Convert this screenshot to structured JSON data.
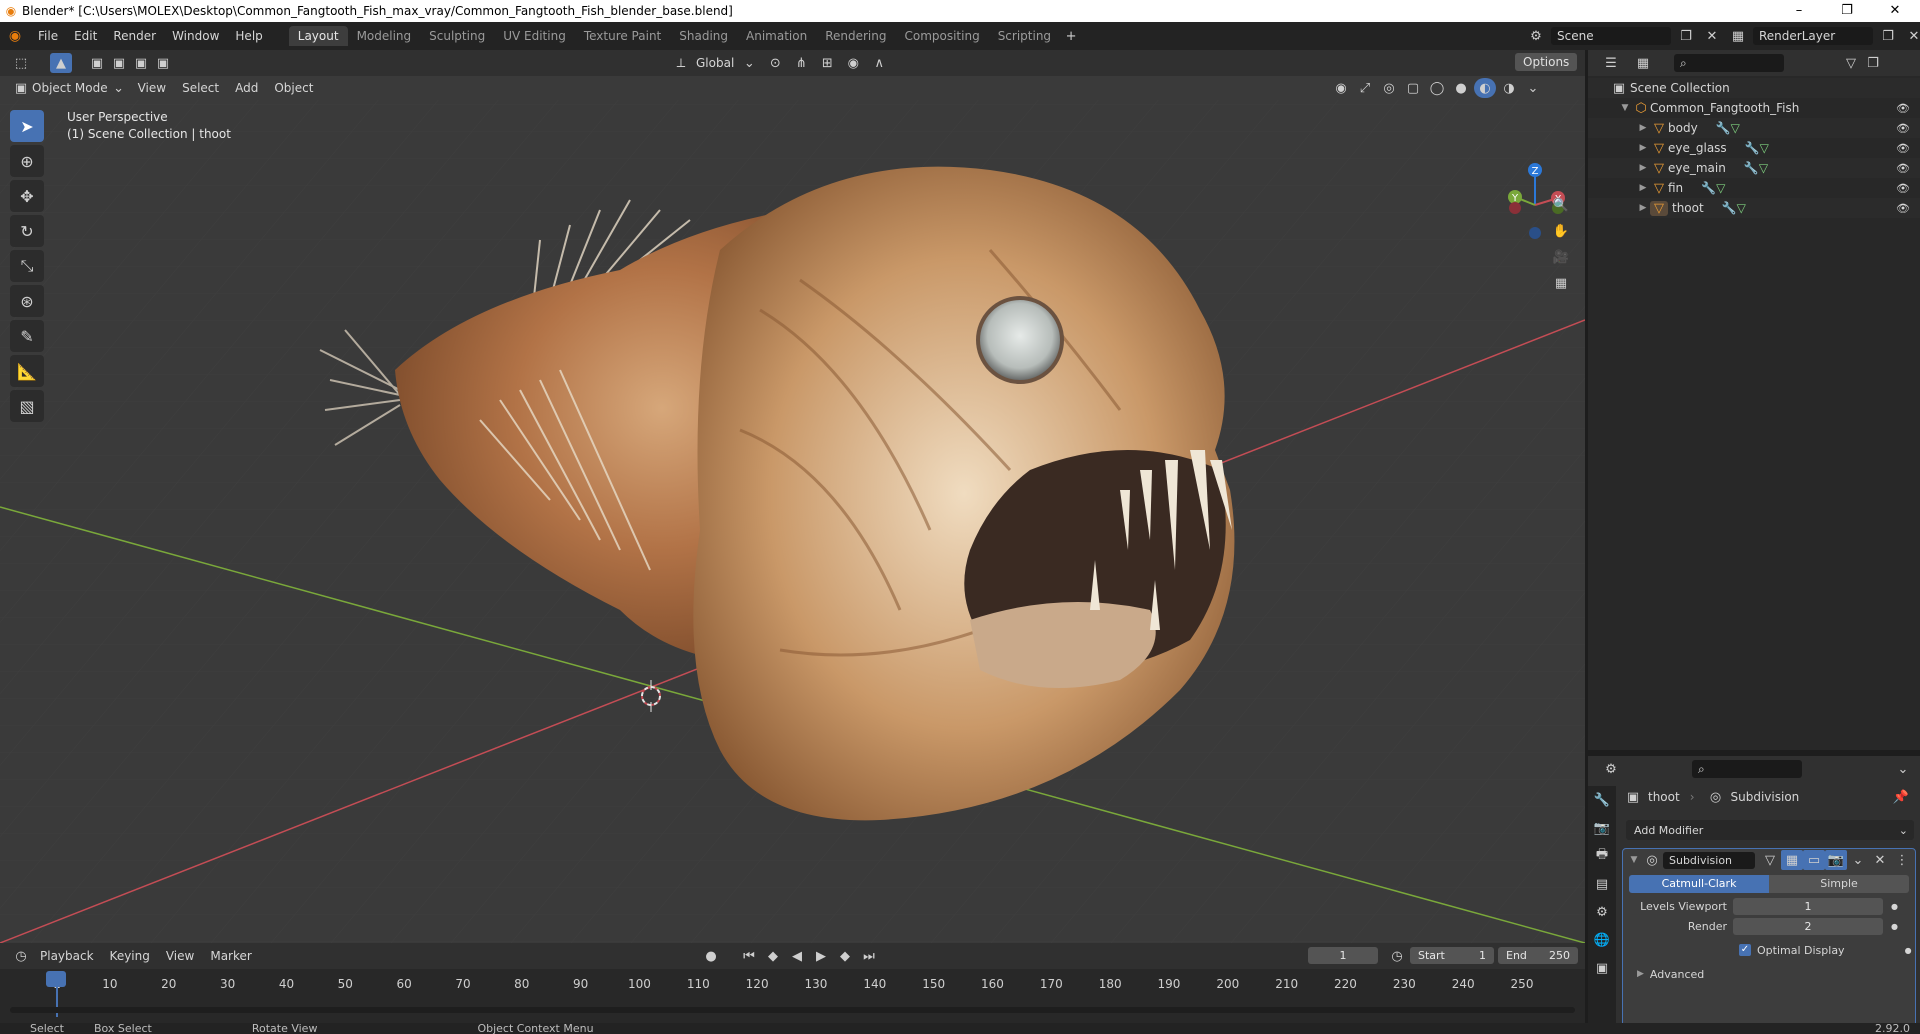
{
  "window": {
    "title": "Blender* [C:\\Users\\MOLEX\\Desktop\\Common_Fangtooth_Fish_max_vray/Common_Fangtooth_Fish_blender_base.blend]",
    "minimize": "–",
    "maximize": "❐",
    "close": "✕"
  },
  "menu": [
    "File",
    "Edit",
    "Render",
    "Window",
    "Help"
  ],
  "workspaces": [
    "Layout",
    "Modeling",
    "Sculpting",
    "UV Editing",
    "Texture Paint",
    "Shading",
    "Animation",
    "Rendering",
    "Compositing",
    "Scripting"
  ],
  "scene": {
    "name": "Scene",
    "render_layer": "RenderLayer"
  },
  "viewport": {
    "mode": "Object Mode",
    "menus": [
      "View",
      "Select",
      "Add",
      "Object"
    ],
    "orientation": "Global",
    "options": "Options",
    "perspective": "User Perspective",
    "collection_info": "(1) Scene Collection | thoot",
    "gizmo_axes": {
      "x": "X",
      "y": "Y",
      "z": "Z"
    }
  },
  "outliner": {
    "root": "Scene Collection",
    "collection": "Common_Fangtooth_Fish",
    "objects": [
      "body",
      "eye_glass",
      "eye_main",
      "fin",
      "thoot"
    ]
  },
  "properties": {
    "object": "thoot",
    "modifier_crumb": "Subdivision",
    "add_modifier": "Add Modifier",
    "modifier_name": "Subdivision",
    "tabs": [
      "Catmull-Clark",
      "Simple"
    ],
    "levels_viewport_label": "Levels Viewport",
    "levels_viewport": "1",
    "render_label": "Render",
    "render": "2",
    "optimal_display": "Optimal Display",
    "advanced": "Advanced"
  },
  "timeline": {
    "menus": [
      "Playback",
      "Keying",
      "View",
      "Marker"
    ],
    "current_frame": "1",
    "start_label": "Start",
    "start": "1",
    "end_label": "End",
    "end": "250",
    "ticks": [
      "1",
      "10",
      "20",
      "30",
      "40",
      "50",
      "60",
      "70",
      "80",
      "90",
      "100",
      "110",
      "120",
      "130",
      "140",
      "150",
      "160",
      "170",
      "180",
      "190",
      "200",
      "210",
      "220",
      "230",
      "240",
      "250"
    ]
  },
  "status": {
    "select": "Select",
    "box_select": "Box Select",
    "rotate_view": "Rotate View",
    "context_menu": "Object Context Menu",
    "version": "2.92.0"
  },
  "colors": {
    "accent": "#4772b3",
    "mesh": "#e89b35",
    "x_axis": "#c44d55",
    "y_axis": "#7aa83a",
    "z_axis": "#2b78d8"
  }
}
